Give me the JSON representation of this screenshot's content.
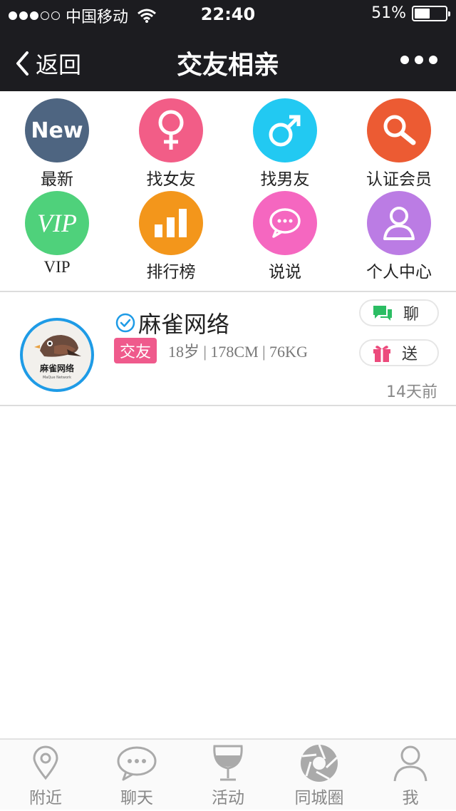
{
  "status_bar": {
    "carrier": "中国移动",
    "time": "22:40",
    "battery": "51%",
    "battery_level": 0.51
  },
  "nav": {
    "back_label": "返回",
    "title": "交友相亲"
  },
  "menu": {
    "items": [
      {
        "label": "最新",
        "icon": "new-icon",
        "color": "#4e6581",
        "icon_text": "New"
      },
      {
        "label": "找女友",
        "icon": "female-icon",
        "color": "#f25d87"
      },
      {
        "label": "找男友",
        "icon": "male-icon",
        "color": "#22c9f2"
      },
      {
        "label": "认证会员",
        "icon": "search-icon",
        "color": "#ec5b33"
      },
      {
        "label": "VIP",
        "icon": "vip-icon",
        "color": "#4fd17b",
        "icon_text": "VIP"
      },
      {
        "label": "排行榜",
        "icon": "ranking-icon",
        "color": "#f3961b"
      },
      {
        "label": "说说",
        "icon": "chat-bubble-icon",
        "color": "#f567c0"
      },
      {
        "label": "个人中心",
        "icon": "user-icon",
        "color": "#bb7ce4"
      }
    ]
  },
  "profile": {
    "name": "麻雀网络",
    "tag": "交友",
    "stats": "18岁 | 178CM | 76KG",
    "chat_label": "聊",
    "gift_label": "送",
    "time_ago": "14天前",
    "avatar_text": "麻雀网络",
    "avatar_subtext": "MaQue Network"
  },
  "tabbar": {
    "items": [
      {
        "label": "附近",
        "icon": "location-pin-icon"
      },
      {
        "label": "聊天",
        "icon": "chat-icon"
      },
      {
        "label": "活动",
        "icon": "wine-glass-icon"
      },
      {
        "label": "同城圈",
        "icon": "aperture-icon"
      },
      {
        "label": "我",
        "icon": "person-icon"
      }
    ]
  },
  "colors": {
    "header_bg": "#1c1c20",
    "tag_bg": "#ef5a8c",
    "avatar_ring": "#1e9be6",
    "chat_green": "#2bbd63",
    "gift_pink": "#ec4a7c",
    "verify_blue": "#1e9be6"
  }
}
